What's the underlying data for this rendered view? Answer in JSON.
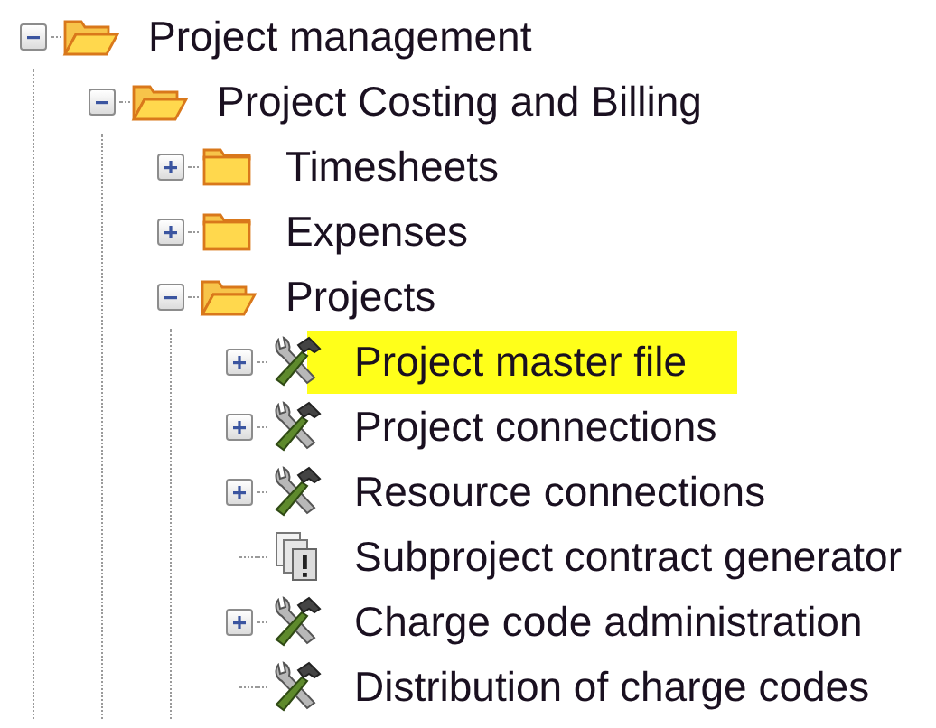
{
  "tree": [
    {
      "label": "Project management",
      "kind": "folder",
      "expandable": true,
      "expanded": true,
      "children": [
        {
          "label": "Project Costing and Billing",
          "kind": "folder",
          "expandable": true,
          "expanded": true,
          "children": [
            {
              "label": "Timesheets",
              "kind": "folder",
              "expandable": true,
              "expanded": false
            },
            {
              "label": "Expenses",
              "kind": "folder",
              "expandable": true,
              "expanded": false
            },
            {
              "label": "Projects",
              "kind": "folder",
              "expandable": true,
              "expanded": true,
              "children": [
                {
                  "label": "Project master file",
                  "kind": "tools",
                  "expandable": true,
                  "expanded": false,
                  "highlighted": true
                },
                {
                  "label": "Project connections",
                  "kind": "tools",
                  "expandable": true,
                  "expanded": false,
                  "highlighted": false
                },
                {
                  "label": "Resource connections",
                  "kind": "tools",
                  "expandable": true,
                  "expanded": false,
                  "highlighted": false
                },
                {
                  "label": "Subproject contract generator",
                  "kind": "report",
                  "expandable": false,
                  "highlighted": false
                },
                {
                  "label": "Charge code administration",
                  "kind": "tools",
                  "expandable": true,
                  "expanded": false,
                  "highlighted": false
                },
                {
                  "label": "Distribution of charge codes",
                  "kind": "tools",
                  "expandable": false,
                  "highlighted": false
                }
              ]
            }
          ]
        }
      ]
    }
  ]
}
